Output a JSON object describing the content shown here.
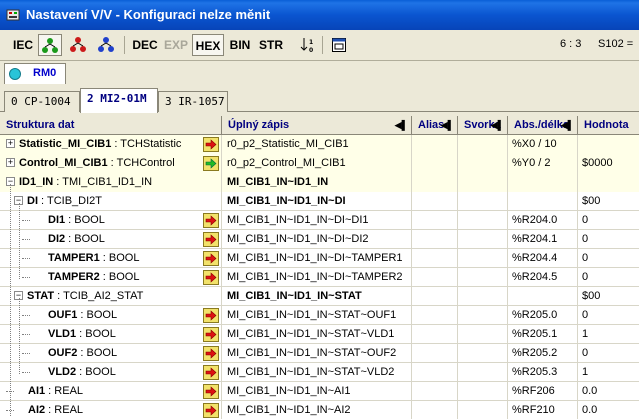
{
  "window": {
    "title": "Nastavení V/V - Konfiguraci nelze měnit"
  },
  "toolbar": {
    "iec": "IEC",
    "dec": "DEC",
    "exp": "EXP",
    "hex": "HEX",
    "bin": "BIN",
    "str": "STR",
    "counter": "6 : 3",
    "s102": "S102 ="
  },
  "rm": {
    "label": "RM0"
  },
  "tabs": [
    "0 CP-1004",
    "2 MI2-01M",
    "3 IR-1057"
  ],
  "columns": [
    "Struktura dat",
    "Úplný zápis",
    "Alias",
    "Svorka",
    "Abs./délka",
    "Hodnota"
  ],
  "rows": [
    {
      "name": "Statistic_MI_CIB1",
      "type": " : TCHStatistic",
      "full": "r0_p2_Statistic_MI_CIB1",
      "abs": "%X0 / 10",
      "val": ""
    },
    {
      "name": "Control_MI_CIB1",
      "type": " : TCHControl",
      "full": "r0_p2_Control_MI_CIB1",
      "abs": "%Y0 / 2",
      "val": "$0000"
    },
    {
      "name": "ID1_IN",
      "type": " : TMI_CIB1_ID1_IN",
      "full": "MI_CIB1_IN~ID1_IN",
      "abs": "",
      "val": ""
    },
    {
      "name": "DI",
      "type": " : TCIB_DI2T",
      "full": "MI_CIB1_IN~ID1_IN~DI",
      "abs": "",
      "val": "$00"
    },
    {
      "name": "DI1",
      "type": " : BOOL",
      "full": "MI_CIB1_IN~ID1_IN~DI~DI1",
      "abs": "%R204.0",
      "val": "0"
    },
    {
      "name": "DI2",
      "type": " : BOOL",
      "full": "MI_CIB1_IN~ID1_IN~DI~DI2",
      "abs": "%R204.1",
      "val": "0"
    },
    {
      "name": "TAMPER1",
      "type": " : BOOL",
      "full": "MI_CIB1_IN~ID1_IN~DI~TAMPER1",
      "abs": "%R204.4",
      "val": "0"
    },
    {
      "name": "TAMPER2",
      "type": " : BOOL",
      "full": "MI_CIB1_IN~ID1_IN~DI~TAMPER2",
      "abs": "%R204.5",
      "val": "0"
    },
    {
      "name": "STAT",
      "type": " : TCIB_AI2_STAT",
      "full": "MI_CIB1_IN~ID1_IN~STAT",
      "abs": "",
      "val": "$00"
    },
    {
      "name": "OUF1",
      "type": " : BOOL",
      "full": "MI_CIB1_IN~ID1_IN~STAT~OUF1",
      "abs": "%R205.0",
      "val": "0"
    },
    {
      "name": "VLD1",
      "type": " : BOOL",
      "full": "MI_CIB1_IN~ID1_IN~STAT~VLD1",
      "abs": "%R205.1",
      "val": "1"
    },
    {
      "name": "OUF2",
      "type": " : BOOL",
      "full": "MI_CIB1_IN~ID1_IN~STAT~OUF2",
      "abs": "%R205.2",
      "val": "0"
    },
    {
      "name": "VLD2",
      "type": " : BOOL",
      "full": "MI_CIB1_IN~ID1_IN~STAT~VLD2",
      "abs": "%R205.3",
      "val": "1"
    },
    {
      "name": "AI1",
      "type": " : REAL",
      "full": "MI_CIB1_IN~ID1_IN~AI1",
      "abs": "%RF206",
      "val": "0.0"
    },
    {
      "name": "AI2",
      "type": " : REAL",
      "full": "MI_CIB1_IN~ID1_IN~AI2",
      "abs": "%RF210",
      "val": "0.0"
    }
  ]
}
